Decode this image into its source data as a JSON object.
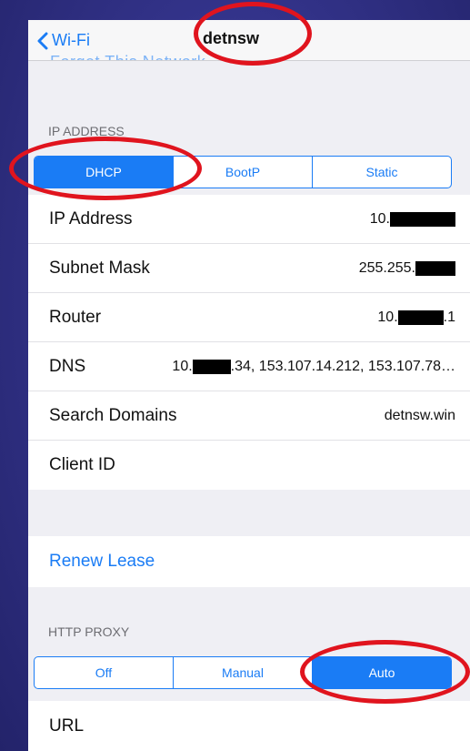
{
  "navbar": {
    "back_label": "Wi-Fi",
    "title": "detnsw",
    "partial_scrolled_text": "Forget This Network"
  },
  "ip_address": {
    "header": "IP ADDRESS",
    "segments": [
      "DHCP",
      "BootP",
      "Static"
    ],
    "selected_segment": "DHCP",
    "rows": {
      "ip_address": {
        "label": "IP Address",
        "value_prefix": "10."
      },
      "subnet_mask": {
        "label": "Subnet Mask",
        "value_prefix": "255.255."
      },
      "router": {
        "label": "Router",
        "value_prefix": "10.",
        "value_suffix": ".1"
      },
      "dns": {
        "label": "DNS",
        "value_prefix": "10.",
        "value_suffix": ".34, 153.107.14.212, 153.107.78…"
      },
      "search_domains": {
        "label": "Search Domains",
        "value": "detnsw.win"
      },
      "client_id": {
        "label": "Client ID",
        "value": ""
      }
    }
  },
  "renew_lease": {
    "label": "Renew Lease"
  },
  "http_proxy": {
    "header": "HTTP PROXY",
    "segments": [
      "Off",
      "Manual",
      "Auto"
    ],
    "selected_segment": "Auto",
    "url_label": "URL"
  },
  "colors": {
    "accent": "#1a7cf5",
    "annotation": "#e0141e",
    "background": "#3a3a96"
  },
  "icons": {
    "back": "chevron-left-icon"
  }
}
